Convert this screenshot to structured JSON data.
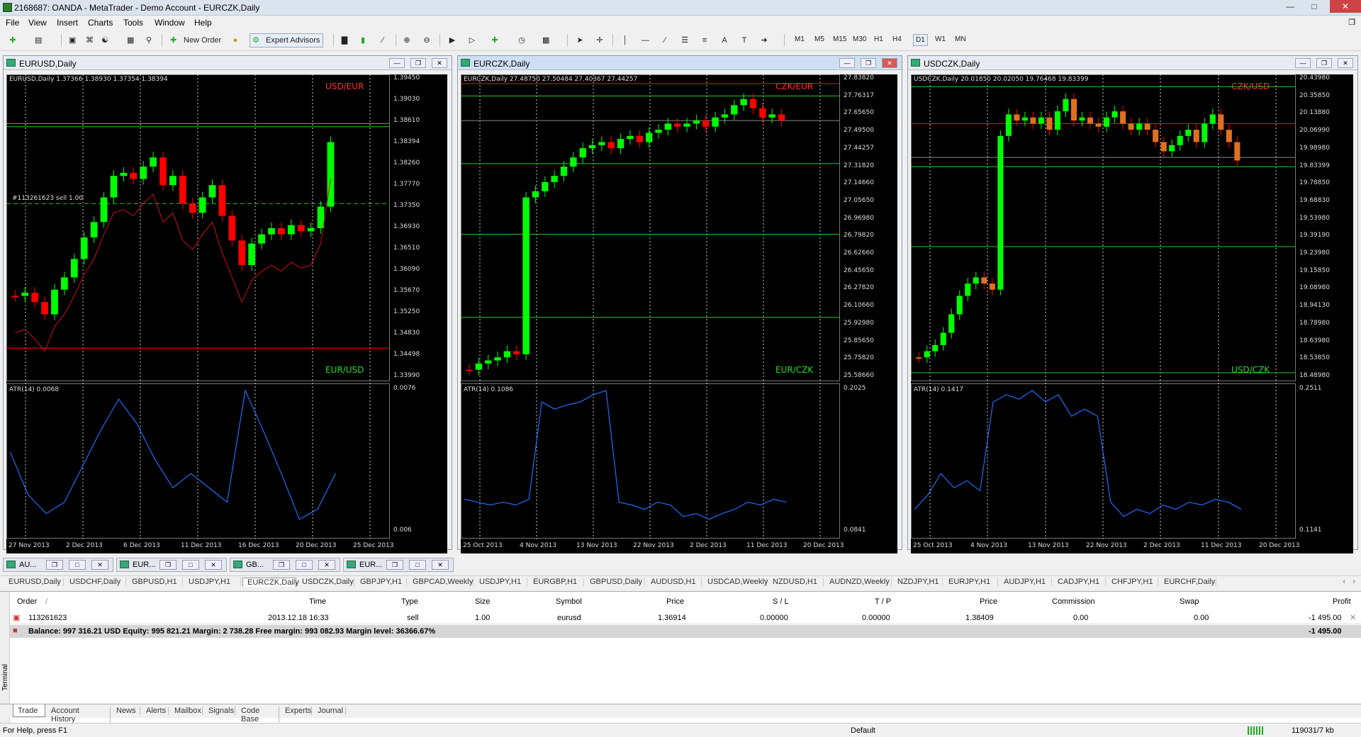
{
  "window": {
    "title": "2168687: OANDA - MetaTrader - Demo Account - EURCZK,Daily"
  },
  "menu": [
    "File",
    "View",
    "Insert",
    "Charts",
    "Tools",
    "Window",
    "Help"
  ],
  "toolbar": {
    "new_order": "New Order",
    "expert_advisors": "Expert Advisors",
    "timeframes": [
      "M1",
      "M5",
      "M15",
      "M30",
      "H1",
      "H4",
      "D1",
      "W1",
      "MN"
    ],
    "selected_tf": "D1"
  },
  "colors": {
    "bull": "#00ff00",
    "bear": "#ff0000",
    "grid": "#ffffff",
    "atr": "#1e6cff",
    "ma": "#d01010",
    "level": "#22cc22"
  },
  "charts": [
    {
      "title": "EURUSD,Daily",
      "info": "EURUSD,Daily  1.37366 1.38930 1.37354 1.38394",
      "cross_top": "USD/EUR",
      "cross_bottom": "EUR/USD",
      "prices": [
        "1.39450",
        "1.39030",
        "1.38610",
        "1.38394",
        "1.38260",
        "1.37770",
        "1.37350",
        "1.36930",
        "1.36510",
        "1.36090",
        "1.35670",
        "1.35250",
        "1.34830",
        "1.34498",
        "1.33990"
      ],
      "order_label": "#113261623 sell 1.00",
      "atr_label": "ATR(14) 0.0068",
      "atr_scale": [
        "0.0076",
        "0.006"
      ],
      "dates": [
        "27 Nov 2013",
        "2 Dec 2013",
        "6 Dec 2013",
        "11 Dec 2013",
        "16 Dec 2013",
        "20 Dec 2013",
        "25 Dec 2013"
      ]
    },
    {
      "title": "EURCZK,Daily",
      "info": "EURCZK,Daily  27.48750 27.50484 27.40367 27.44257",
      "cross_top": "CZK/EUR",
      "cross_bottom": "EUR/CZK",
      "prices": [
        "27.83820",
        "27.76317",
        "27.65650",
        "27.49500",
        "27.44257",
        "27.31820",
        "27.14660",
        "27.05650",
        "26.96980",
        "26.79820",
        "26.62660",
        "26.45650",
        "26.27820",
        "26.10660",
        "25.92980",
        "25.85650",
        "25.75820",
        "25.58660"
      ],
      "atr_label": "ATR(14) 0.1086",
      "atr_scale": [
        "0.2025",
        "0.0841"
      ],
      "dates": [
        "25 Oct 2013",
        "4 Nov 2013",
        "13 Nov 2013",
        "22 Nov 2013",
        "2 Dec 2013",
        "11 Dec 2013",
        "20 Dec 2013"
      ]
    },
    {
      "title": "USDCZK,Daily",
      "info": "USDCZK,Daily  20.01850 20.02050 19.76468 19.83399",
      "cross_top": "CZK/USD",
      "cross_bottom": "USD/CZK",
      "prices": [
        "20.43980",
        "20.35850",
        "20.13880",
        "20.06990",
        "19.98980",
        "19.83399",
        "19.78850",
        "19.68830",
        "19.53980",
        "19.39190",
        "19.23980",
        "19.15850",
        "19.08980",
        "18.94130",
        "18.78980",
        "18.63980",
        "18.53850",
        "18.48980"
      ],
      "atr_label": "ATR(14) 0.1417",
      "atr_scale": [
        "0.2511",
        "0.1141"
      ],
      "dates": [
        "25 Oct 2013",
        "4 Nov 2013",
        "13 Nov 2013",
        "22 Nov 2013",
        "2 Dec 2013",
        "11 Dec 2013",
        "20 Dec 2013"
      ]
    }
  ],
  "minimized": [
    "AU...",
    "EUR...",
    "GB...",
    "EUR..."
  ],
  "symbol_tabs": [
    "EURUSD,Daily",
    "USDCHF,Daily",
    "GBPUSD,H1",
    "USDJPY,H1",
    "EURCZK,Daily",
    "USDCZK,Daily",
    "GBPJPY,H1",
    "GBPCAD,Weekly",
    "USDJPY,H1",
    "EURGBP,H1",
    "GBPUSD,Daily",
    "AUDUSD,H1",
    "USDCAD,Weekly",
    "NZDUSD,H1",
    "AUDNZD,Weekly",
    "NZDJPY,H1",
    "EURJPY,H1",
    "AUDJPY,H1",
    "CADJPY,H1",
    "CHFJPY,H1",
    "EURCHF,Daily"
  ],
  "selected_symbol_tab": "EURCZK,Daily",
  "terminal": {
    "side_label": "Terminal",
    "headers": [
      "Order",
      "/",
      "Time",
      "Type",
      "Size",
      "Symbol",
      "Price",
      "S / L",
      "T / P",
      "Price",
      "Commission",
      "Swap",
      "Profit"
    ],
    "order": {
      "id": "113261623",
      "time": "2013.12.18 16:33",
      "type": "sell",
      "size": "1.00",
      "symbol": "eurusd",
      "price": "1.36914",
      "sl": "0.00000",
      "tp": "0.00000",
      "cur_price": "1.38409",
      "commission": "0.00",
      "swap": "0.00",
      "profit": "-1 495.00"
    },
    "balance": "Balance: 997 316.21 USD  Equity: 995 821.21  Margin: 2 738.28  Free margin: 993 082.93  Margin level: 36366.67%",
    "balance_profit": "-1 495.00",
    "tabs": [
      "Trade",
      "Account History",
      "News",
      "Alerts",
      "Mailbox",
      "Signals",
      "Code Base",
      "Experts",
      "Journal"
    ],
    "selected_tab": "Trade"
  },
  "status": {
    "help": "For Help, press F1",
    "profile": "Default",
    "traffic": "119031/7 kb"
  }
}
